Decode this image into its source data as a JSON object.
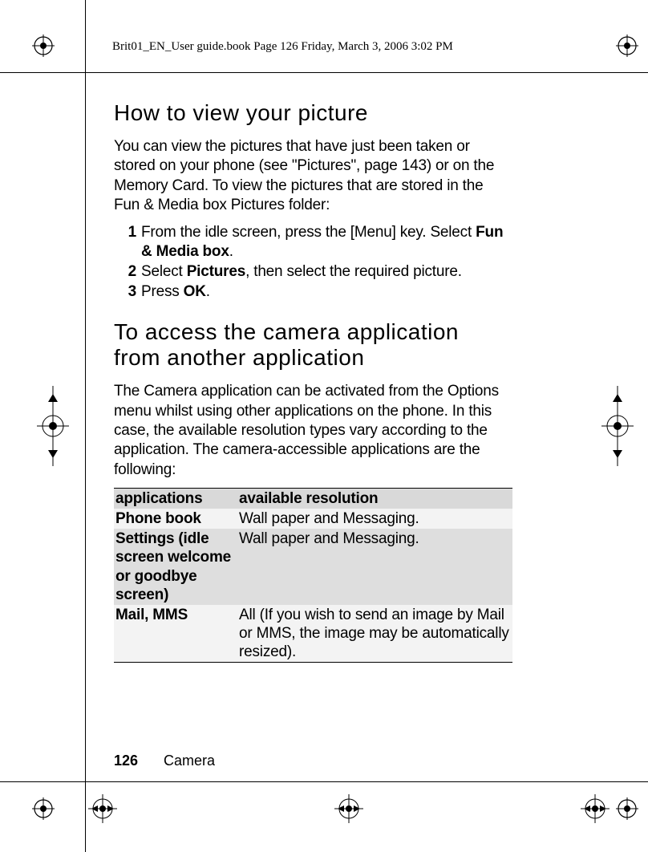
{
  "header": "Brit01_EN_User guide.book  Page 126  Friday, March 3, 2006  3:02 PM",
  "h1": "How to view your picture",
  "p1": "You can view the pictures that have just been taken or stored on your phone (see \"Pictures\", page 143) or on the Memory Card. To view the pictures that are stored in the Fun & Media box Pictures folder:",
  "steps": [
    {
      "n": "1",
      "pre": "From the idle screen, press the [Menu] key. Select ",
      "b": "Fun & Media box",
      "post": "."
    },
    {
      "n": "2",
      "pre": "Select ",
      "b": "Pictures",
      "post": ", then select the required picture."
    },
    {
      "n": "3",
      "pre": "Press ",
      "b": "OK",
      "post": "."
    }
  ],
  "h2": "To access the camera application from another application",
  "p2": "The Camera application can be activated from the Options menu whilst using other applications on the phone. In this case, the available resolution types vary according to the application. The camera-accessible applications are the following:",
  "table": {
    "head": [
      "applications",
      "available resolution"
    ],
    "rows": [
      [
        "Phone book",
        "Wall paper and Messaging."
      ],
      [
        "Settings (idle screen welcome or goodbye screen)",
        "Wall paper and Messaging."
      ],
      [
        "Mail, MMS",
        "All (If you wish to send an image by Mail or MMS, the image may be automatically resized)."
      ]
    ]
  },
  "footer": {
    "page": "126",
    "chapter": "Camera"
  }
}
